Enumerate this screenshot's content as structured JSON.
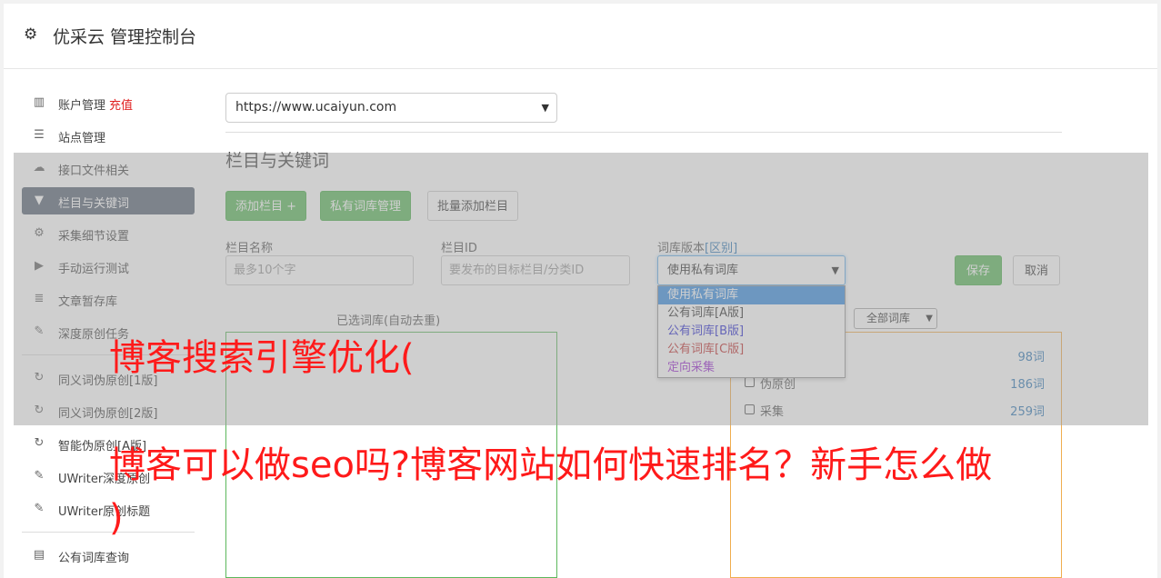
{
  "app": {
    "title": "优采云 管理控制台"
  },
  "sidebar": {
    "items": [
      {
        "label": "账户管理",
        "extra": "充值",
        "icon": "bar-chart-icon"
      },
      {
        "label": "站点管理",
        "icon": "server-icon"
      },
      {
        "label": "接口文件相关",
        "icon": "cloud-upload-icon"
      },
      {
        "label": "栏目与关键词",
        "icon": "filter-icon",
        "active": true
      },
      {
        "label": "采集细节设置",
        "icon": "cogs-icon"
      },
      {
        "label": "手动运行测试",
        "icon": "play-icon"
      },
      {
        "label": "文章暂存库",
        "icon": "database-icon"
      },
      {
        "label": "深度原创任务",
        "icon": "edit-icon"
      }
    ],
    "items2": [
      {
        "label": "同义词伪原创[1版]",
        "icon": "refresh-icon"
      },
      {
        "label": "同义词伪原创[2版]",
        "icon": "refresh-icon"
      },
      {
        "label": "智能伪原创[A版]",
        "icon": "refresh-icon"
      },
      {
        "label": "UWriter深度原创",
        "icon": "edit-icon"
      },
      {
        "label": "UWriter原创标题",
        "icon": "edit-icon"
      }
    ],
    "items3": [
      {
        "label": "公有词库查询",
        "icon": "book-icon"
      }
    ]
  },
  "main": {
    "site_select": "https://www.ucaiyun.com",
    "section_title": "栏目与关键词",
    "buttons": {
      "add_column": "添加栏目 +",
      "private_lib": "私有词库管理",
      "batch_add": "批量添加栏目",
      "save": "保存",
      "cancel": "取消"
    },
    "form": {
      "name_label": "栏目名称",
      "name_placeholder": "最多10个字",
      "id_label": "栏目ID",
      "id_placeholder": "要发布的目标栏目/分类ID",
      "version_label": "词库版本",
      "version_link": "[区别]",
      "version_value": "使用私有词库"
    },
    "version_options": [
      {
        "label": "使用私有词库",
        "color": "#ffffff",
        "selected": true
      },
      {
        "label": "公有词库[A版]",
        "color": "#333333"
      },
      {
        "label": "公有词库[B版]",
        "color": "#2b2bd0"
      },
      {
        "label": "公有词库[C版]",
        "color": "#c03030"
      },
      {
        "label": "定向采集",
        "color": "#9b2bd0"
      }
    ],
    "selected_box_title": "已选词库(自动去重)",
    "library_filter": "全部词库",
    "libraries": [
      {
        "name": "",
        "count": "98词"
      },
      {
        "name": "伪原创",
        "count": "186词"
      },
      {
        "name": "采集",
        "count": "259词"
      }
    ]
  },
  "watermark": {
    "line1": "博客搜索引擎优化(",
    "line2": "博客可以做seo吗?博客网站如何快速排名？新手怎么做",
    "line3": ")"
  },
  "colors": {
    "accent_green": "#5cb85c",
    "nav_active": "#5b6677",
    "watermark": "#ff1a1a",
    "selected_border": "#5cb85c",
    "library_border": "#f0ad4e"
  }
}
